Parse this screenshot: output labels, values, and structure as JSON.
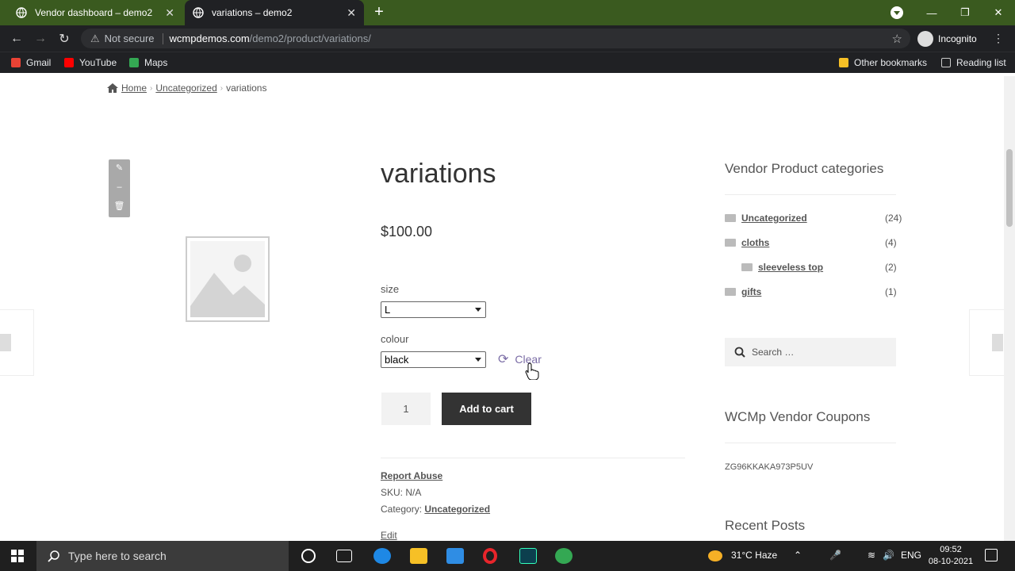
{
  "browser": {
    "tabs": [
      {
        "title": "Vendor dashboard – demo2",
        "active": false
      },
      {
        "title": "variations – demo2",
        "active": true
      }
    ],
    "new_tab": "+",
    "security_label": "Not secure",
    "url_host": "wcmpdemos.com",
    "url_path": "/demo2/product/variations/",
    "profile_label": "Incognito",
    "bookmarks": [
      {
        "label": "Gmail",
        "color": "#ea4335"
      },
      {
        "label": "YouTube",
        "color": "#ff0000"
      },
      {
        "label": "Maps",
        "color": "#34a853"
      }
    ],
    "other_bookmarks": "Other bookmarks",
    "reading_list": "Reading list"
  },
  "breadcrumb": {
    "home": "Home",
    "category": "Uncategorized",
    "current": "variations"
  },
  "product": {
    "title": "variations",
    "price": "$100.00",
    "size_label": "size",
    "size_value": "L",
    "colour_label": "colour",
    "colour_value": "black",
    "clear_label": "Clear",
    "quantity": "1",
    "add_to_cart": "Add to cart",
    "report_abuse": "Report Abuse",
    "sku": "SKU: N/A",
    "category_prefix": "Category: ",
    "category_link": "Uncategorized",
    "edit": "Edit"
  },
  "sidebar": {
    "categories_title": "Vendor Product categories",
    "categories": [
      {
        "name": "Uncategorized",
        "count": "(24)"
      },
      {
        "name": "cloths",
        "count": "(4)"
      },
      {
        "name": "sleeveless top",
        "count": "(2)"
      },
      {
        "name": "gifts",
        "count": "(1)"
      }
    ],
    "search_placeholder": "Search …",
    "coupons_title": "WCMp Vendor Coupons",
    "coupon_code": "ZG96KKAKA973P5UV",
    "recent_posts_title": "Recent Posts"
  },
  "taskbar": {
    "search_placeholder": "Type here to search",
    "weather": "31°C  Haze",
    "language": "ENG",
    "time": "09:52",
    "date": "08-10-2021"
  },
  "colors": {
    "tabstrip": "#3a5a1f",
    "link_accent": "#7b6da6",
    "button_dark": "#333333"
  }
}
